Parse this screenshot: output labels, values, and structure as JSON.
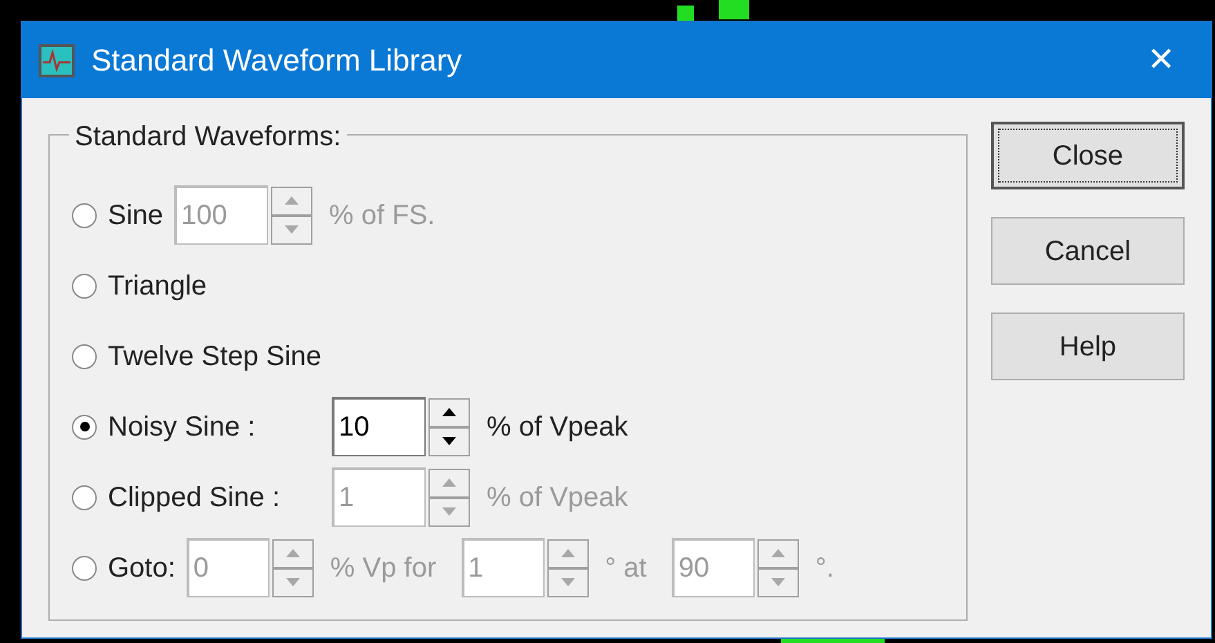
{
  "window": {
    "title": "Standard Waveform Library",
    "close": "✕"
  },
  "group": {
    "label": "Standard Waveforms:"
  },
  "rows": [
    {
      "kind": "spin",
      "label": "Sine",
      "selected": false,
      "inputs": [
        {
          "value": "100",
          "disabled": true,
          "suffix": "% of FS."
        }
      ]
    },
    {
      "kind": "plain",
      "label": "Triangle",
      "selected": false
    },
    {
      "kind": "plain",
      "label": "Twelve Step Sine",
      "selected": false
    },
    {
      "kind": "aligned",
      "label": "Noisy Sine :",
      "selected": true,
      "inputs": [
        {
          "value": "10",
          "disabled": false,
          "suffix": "% of Vpeak"
        }
      ]
    },
    {
      "kind": "aligned",
      "label": "Clipped Sine :",
      "selected": false,
      "inputs": [
        {
          "value": "1",
          "disabled": true,
          "suffix": "% of Vpeak"
        }
      ]
    },
    {
      "kind": "spin",
      "label": "Goto:",
      "selected": false,
      "inputs": [
        {
          "value": "0",
          "disabled": true,
          "suffix": "% Vp for"
        },
        {
          "value": "1",
          "disabled": true,
          "suffix": "° at"
        },
        {
          "value": "90",
          "disabled": true,
          "suffix": "°."
        }
      ]
    }
  ],
  "buttons": [
    {
      "label": "Close",
      "focused": true
    },
    {
      "label": "Cancel",
      "focused": false
    },
    {
      "label": "Help",
      "focused": false
    }
  ]
}
